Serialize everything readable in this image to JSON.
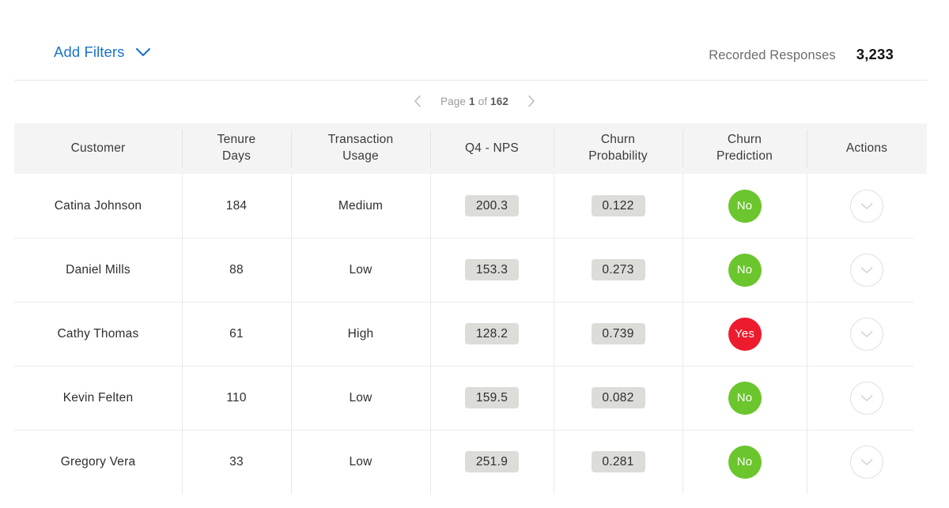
{
  "toolbar": {
    "add_filters_label": "Add Filters",
    "add_filters_icon": "chevron-down-icon",
    "recorded_label": "Recorded Responses",
    "recorded_value": "3,233",
    "accent_color": "#1a74c9"
  },
  "pagination": {
    "prev_icon": "chevron-left-icon",
    "next_icon": "chevron-right-icon",
    "prefix": "Page",
    "current_page": "1",
    "of_label": "of",
    "total_pages": "162"
  },
  "table": {
    "columns": [
      {
        "key": "customer",
        "label_line1": "Customer",
        "label_line2": ""
      },
      {
        "key": "tenure",
        "label_line1": "Tenure",
        "label_line2": "Days"
      },
      {
        "key": "usage",
        "label_line1": "Transaction",
        "label_line2": "Usage"
      },
      {
        "key": "nps",
        "label_line1": "Q4 - NPS",
        "label_line2": ""
      },
      {
        "key": "prob",
        "label_line1": "Churn",
        "label_line2": "Probability"
      },
      {
        "key": "pred",
        "label_line1": "Churn",
        "label_line2": "Prediction"
      },
      {
        "key": "actions",
        "label_line1": "Actions",
        "label_line2": ""
      }
    ],
    "rows": [
      {
        "customer": "Catina Johnson",
        "tenure": "184",
        "usage": "Medium",
        "nps": "200.3",
        "prob": "0.122",
        "pred": "No",
        "pred_state": "no",
        "action_icon": "chevron-down-icon"
      },
      {
        "customer": "Daniel Mills",
        "tenure": "88",
        "usage": "Low",
        "nps": "153.3",
        "prob": "0.273",
        "pred": "No",
        "pred_state": "no",
        "action_icon": "chevron-down-icon"
      },
      {
        "customer": "Cathy Thomas",
        "tenure": "61",
        "usage": "High",
        "nps": "128.2",
        "prob": "0.739",
        "pred": "Yes",
        "pred_state": "yes",
        "action_icon": "chevron-down-icon"
      },
      {
        "customer": "Kevin Felten",
        "tenure": "110",
        "usage": "Low",
        "nps": "159.5",
        "prob": "0.082",
        "pred": "No",
        "pred_state": "no",
        "action_icon": "chevron-down-icon"
      },
      {
        "customer": "Gregory Vera",
        "tenure": "33",
        "usage": "Low",
        "nps": "251.9",
        "prob": "0.281",
        "pred": "No",
        "pred_state": "no",
        "action_icon": "chevron-down-icon"
      }
    ]
  },
  "colors": {
    "churn_no": "#6bc52d",
    "churn_yes": "#ed1b2d",
    "badge_bg": "#dcdcd9",
    "header_bg": "#f4f4f4"
  }
}
